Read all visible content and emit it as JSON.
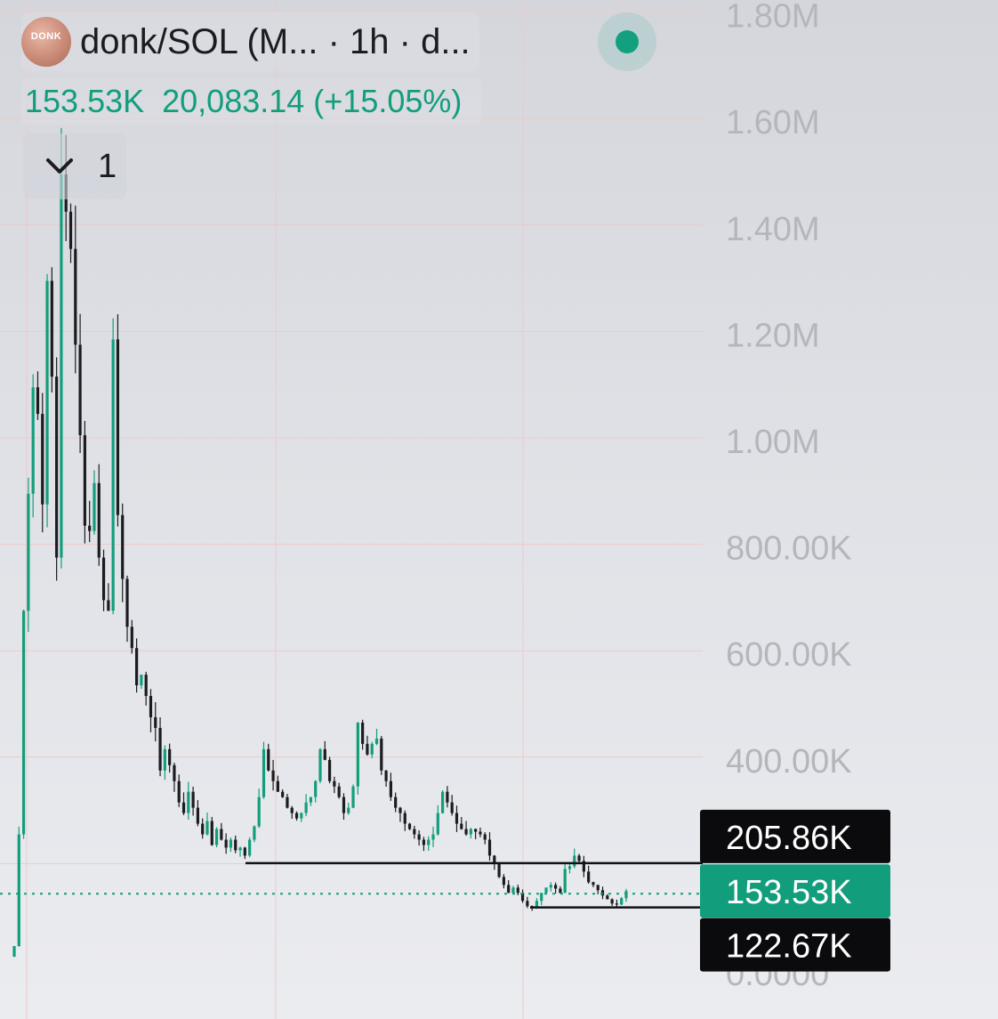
{
  "header": {
    "symbol_title": "donk/SOL (M...  · 1h · d...",
    "avatar_text": "DONK",
    "last_value": "153.53K",
    "change_text": "20,083.14 (+15.05%)",
    "collapse_count": "1",
    "up_color": "#129e7c",
    "down_color": "#1b1c20",
    "live_status_color": "#12a07e"
  },
  "chart_data": {
    "type": "candlestick",
    "title": "",
    "xlabel": "",
    "ylabel": "",
    "timeframe": "1h",
    "y_axis_position": "right",
    "ylim": [
      0,
      1900000
    ],
    "y_ticks": [
      0,
      400000,
      600000,
      800000,
      1000000,
      1200000,
      1400000,
      1600000,
      1800000
    ],
    "y_tick_labels": [
      "0.0000",
      "400.00K",
      "600.00K",
      "800.00K",
      "1.00M",
      "1.20M",
      "1.40M",
      "1.60M",
      "1.80M"
    ],
    "grid": true,
    "current_price": 153530,
    "current_price_label": "153.53K",
    "horizontal_lines": [
      {
        "value": 205860,
        "label": "205.86K"
      },
      {
        "value": 122670,
        "label": "122.67K"
      }
    ],
    "close_series": [
      50000,
      260000,
      680000,
      900000,
      1100000,
      1050000,
      880000,
      1300000,
      1120000,
      780000,
      1500000,
      1430000,
      1360000,
      1180000,
      1010000,
      840000,
      830000,
      920000,
      780000,
      700000,
      680000,
      1190000,
      860000,
      740000,
      650000,
      610000,
      540000,
      560000,
      520000,
      480000,
      460000,
      380000,
      420000,
      390000,
      360000,
      320000,
      300000,
      340000,
      310000,
      280000,
      260000,
      285000,
      240000,
      270000,
      250000,
      235000,
      250000,
      230000,
      235000,
      220000,
      250000,
      275000,
      330000,
      420000,
      380000,
      360000,
      340000,
      330000,
      310000,
      300000,
      290000,
      300000,
      320000,
      330000,
      360000,
      420000,
      400000,
      360000,
      350000,
      330000,
      300000,
      310000,
      350000,
      470000,
      430000,
      410000,
      430000,
      440000,
      380000,
      360000,
      330000,
      310000,
      300000,
      280000,
      270000,
      260000,
      250000,
      240000,
      250000,
      260000,
      300000,
      340000,
      320000,
      300000,
      280000,
      270000,
      260000,
      270000,
      265000,
      260000,
      250000,
      220000,
      205000,
      180000,
      165000,
      150000,
      160000,
      150000,
      135000,
      125000,
      123000,
      135000,
      150000,
      160000,
      165000,
      158000,
      150000,
      195000,
      200000,
      220000,
      210000,
      190000,
      170000,
      165000,
      155000,
      145000,
      138000,
      130000,
      128000,
      140000,
      153530
    ]
  }
}
